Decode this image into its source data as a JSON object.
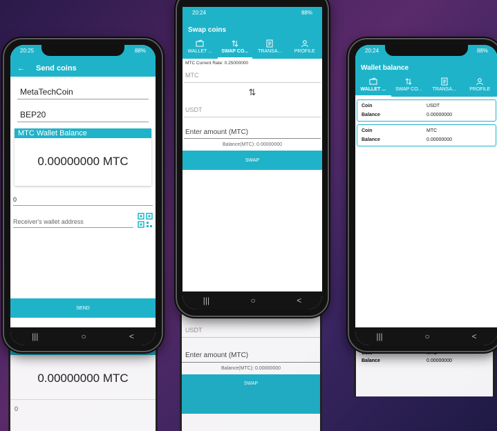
{
  "colors": {
    "accent": "#1fb3c9",
    "accent_dark": "#17a3b8"
  },
  "phone1": {
    "time": "20:25",
    "battery": "88%",
    "title": "Send coins",
    "back_icon": "arrow-left-icon",
    "coin": "MetaTechCoin",
    "network": "BEP20",
    "balance_header": "MTC Wallet Balance",
    "balance": "0.00000000 MTC",
    "amount": "0",
    "address_placeholder": "Receiver's wallet address",
    "qr_icon": "qr-code-icon",
    "send_label": "SEND"
  },
  "phone2": {
    "time": "20:24",
    "battery": "88%",
    "title": "Swap coins",
    "tabs": [
      {
        "label": "WALLET ...",
        "icon": "wallet-icon"
      },
      {
        "label": "SWAP CO...",
        "icon": "swap-icon"
      },
      {
        "label": "TRANSA...",
        "icon": "receipt-icon"
      },
      {
        "label": "PROFILE",
        "icon": "user-icon"
      }
    ],
    "rate": "MTC Current Rate: 0.25000000",
    "from_coin": "MTC",
    "to_coin": "USDT",
    "amount_placeholder": "Enter amount (MTC)",
    "balance": "Balance(MTC): 0.00000000",
    "swap_label": "SWAP"
  },
  "phone3": {
    "time": "20:24",
    "battery": "88%",
    "title": "Wallet balance",
    "tabs": [
      {
        "label": "WALLET ...",
        "icon": "wallet-icon"
      },
      {
        "label": "SWAP CO...",
        "icon": "swap-icon"
      },
      {
        "label": "TRANSA...",
        "icon": "receipt-icon"
      },
      {
        "label": "PROFILE",
        "icon": "user-icon"
      }
    ],
    "cards": [
      {
        "coin_label": "Coin",
        "coin": "USDT",
        "balance_label": "Balance",
        "balance": "0.00000000"
      },
      {
        "coin_label": "Coin",
        "coin": "MTC",
        "balance_label": "Balance",
        "balance": "0.00000000"
      }
    ]
  },
  "reflections": {
    "left": {
      "balance": "0.00000000 MTC",
      "amount": "0"
    },
    "middle": {
      "to_coin": "USDT",
      "amount_placeholder": "Enter amount (MTC)",
      "balance": "Balance(MTC): 0.00000000",
      "swap_label": "SWAP"
    },
    "right": {
      "coin_label": "Coin",
      "coin": "MTC",
      "balance_label": "Balance",
      "balance": "0.00000000"
    }
  }
}
